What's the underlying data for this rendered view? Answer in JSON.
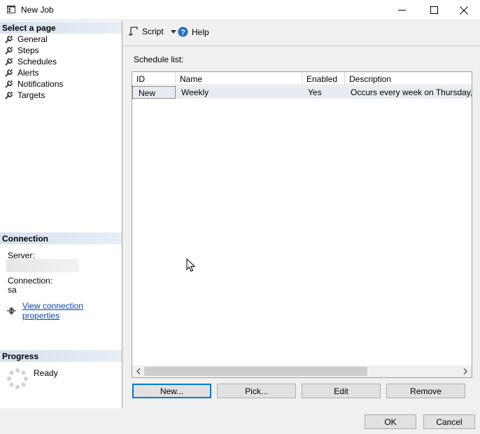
{
  "window": {
    "title": "New Job"
  },
  "nav": {
    "header": "Select a page",
    "items": [
      "General",
      "Steps",
      "Schedules",
      "Alerts",
      "Notifications",
      "Targets"
    ]
  },
  "connection": {
    "header": "Connection",
    "server_label": "Server:",
    "connection_label": "Connection:",
    "connection_value": "sa",
    "link_text": "View connection properties"
  },
  "progress": {
    "header": "Progress",
    "status": "Ready"
  },
  "toolbar": {
    "script_label": "Script",
    "help_label": "Help"
  },
  "schedule": {
    "list_label": "Schedule list:",
    "columns": [
      "ID",
      "Name",
      "Enabled",
      "Description"
    ],
    "rows": [
      {
        "id": "New",
        "name": "Weekly",
        "enabled": "Yes",
        "description": "Occurs every week on Thursday, Sat"
      }
    ]
  },
  "buttons": {
    "new": "New...",
    "pick": "Pick...",
    "edit": "Edit",
    "remove": "Remove",
    "ok": "OK",
    "cancel": "Cancel"
  },
  "colors": {
    "link": "#0645ad",
    "focus": "#0078d7",
    "help_icon": "#1f6fc5"
  }
}
